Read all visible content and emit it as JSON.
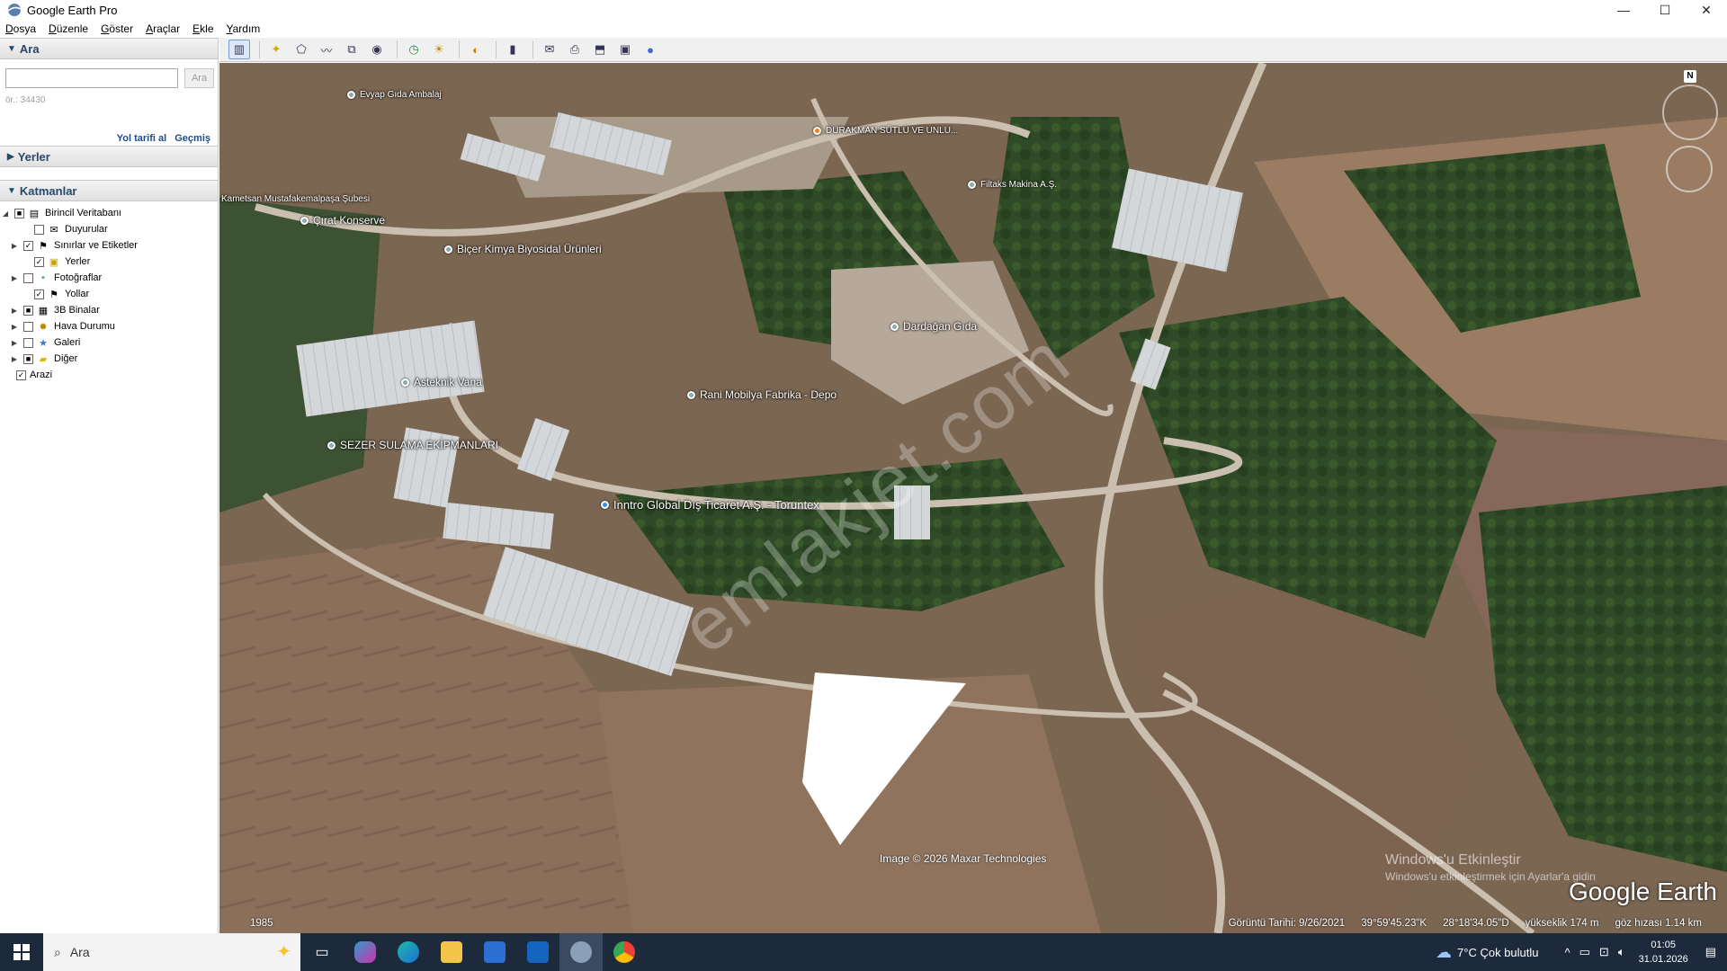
{
  "window": {
    "title": "Google Earth Pro",
    "controls": [
      "—",
      "☐",
      "✕"
    ]
  },
  "menu": [
    "Dosya",
    "Düzenle",
    "Göster",
    "Araçlar",
    "Ekle",
    "Yardım"
  ],
  "search_panel": {
    "title": "Ara",
    "input_value": "",
    "button": "Ara",
    "hint": "ör.: 34430",
    "link_directions": "Yol tarifi al",
    "link_history": "Geçmiş"
  },
  "places_panel": {
    "title": "Yerler"
  },
  "layers_panel": {
    "title": "Katmanlar",
    "root": "Birincil Veritabanı",
    "items": [
      {
        "label": "Duyurular",
        "checked": "",
        "expand": ""
      },
      {
        "label": "Sınırlar ve Etiketler",
        "checked": "✓",
        "expand": "▶"
      },
      {
        "label": "Yerler",
        "checked": "✓",
        "expand": ""
      },
      {
        "label": "Fotoğraflar",
        "checked": "",
        "expand": "▶"
      },
      {
        "label": "Yollar",
        "checked": "✓",
        "expand": ""
      },
      {
        "label": "3B Binalar",
        "checked": "■",
        "expand": "▶"
      },
      {
        "label": "Hava Durumu",
        "checked": "",
        "expand": "▶"
      },
      {
        "label": "Galeri",
        "checked": "",
        "expand": "▶"
      },
      {
        "label": "Diğer",
        "checked": "■",
        "expand": "▶"
      },
      {
        "label": "Arazi",
        "checked": "✓",
        "expand": ""
      }
    ]
  },
  "map_labels": [
    {
      "text": "Evyap Gıda Ambalaj",
      "size": "small"
    },
    {
      "text": "DURAKMAN SÜTLÜ VE UNLU...",
      "size": "small"
    },
    {
      "text": "Kametsan Mustafakemalpaşa Şubesi",
      "size": "small"
    },
    {
      "text": "Filtaks Makina A.Ş.",
      "size": "small"
    },
    {
      "text": "Çırat Konserve",
      "size": "normal"
    },
    {
      "text": "Biçer Kimya Biyosidal Ürünleri",
      "size": "normal"
    },
    {
      "text": "Dardağan Gıda",
      "size": "normal"
    },
    {
      "text": "Asteknik Vana",
      "size": "normal"
    },
    {
      "text": "Rani Mobilya Fabrika - Depo",
      "size": "normal"
    },
    {
      "text": "SEZER SULAMA EKİPMANLARI",
      "size": "normal"
    },
    {
      "text": "Inntro Global Dış Ticaret A.Ş. - Toruntex",
      "size": "big"
    }
  ],
  "watermark": "emlakjet.com",
  "image_credit": "Image © 2026 Maxar Technologies",
  "windows_activation": {
    "title": "Windows'u Etkinleştir",
    "sub": "Windows'u etkinleştirmek için Ayarlar'a gidin"
  },
  "logo": "Google Earth",
  "status": {
    "year": "1985",
    "imagery_date": "Görüntü Tarihi: 9/26/2021",
    "lat": "39°59'45.23\"K",
    "lon": "28°18'34.05\"D",
    "elevation": "yükseklik   174 m",
    "eye_alt": "göz hızası   1.14 km"
  },
  "compass_label": "N",
  "taskbar": {
    "search_placeholder": "Ara",
    "weather": "7°C  Çok bulutlu",
    "time": "01:05",
    "date": "31.01.2026"
  },
  "colors": {
    "sidebar_header": "#27476f",
    "taskbar": "#1c2a3c"
  }
}
